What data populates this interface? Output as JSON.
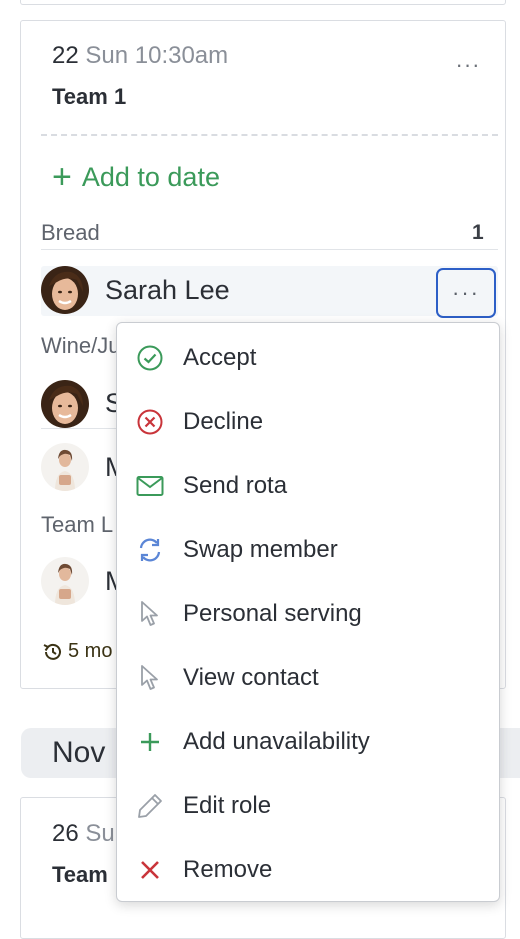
{
  "event": {
    "date_day": "22",
    "date_rest": "Sun 10:30am",
    "team": "Team 1",
    "more_glyph": "···",
    "add_to_date": "Add to date",
    "sections": [
      {
        "label": "Bread",
        "count": "1"
      },
      {
        "label": "Wine/Ju"
      },
      {
        "label": "Team L"
      }
    ],
    "members": [
      {
        "name": "Sarah Lee",
        "avatar": "woman-avatar"
      },
      {
        "name": "S",
        "avatar": "woman-avatar"
      },
      {
        "name": "M",
        "avatar": "woman-holding-avatar"
      },
      {
        "name": "M",
        "avatar": "woman-holding-avatar"
      }
    ],
    "history": "5 mo"
  },
  "month_label": "Nov",
  "next_event": {
    "date_day": "26",
    "date_rest": "Su",
    "team": "Team"
  },
  "menu": {
    "items": [
      {
        "label": "Accept",
        "icon": "check-circle-icon",
        "color": "#3b9a5a"
      },
      {
        "label": "Decline",
        "icon": "x-circle-icon",
        "color": "#c9343a"
      },
      {
        "label": "Send rota",
        "icon": "envelope-icon",
        "color": "#3b9a5a"
      },
      {
        "label": "Swap member",
        "icon": "swap-arrows-icon",
        "color": "#5b86d6"
      },
      {
        "label": "Personal serving",
        "icon": "cursor-icon",
        "color": "#9aa0a8"
      },
      {
        "label": "View contact",
        "icon": "cursor-icon",
        "color": "#9aa0a8"
      },
      {
        "label": "Add unavailability",
        "icon": "plus-icon",
        "color": "#3b9a5a"
      },
      {
        "label": "Edit role",
        "icon": "pencil-icon",
        "color": "#9aa0a8"
      },
      {
        "label": "Remove",
        "icon": "x-icon",
        "color": "#c9343a"
      }
    ]
  }
}
